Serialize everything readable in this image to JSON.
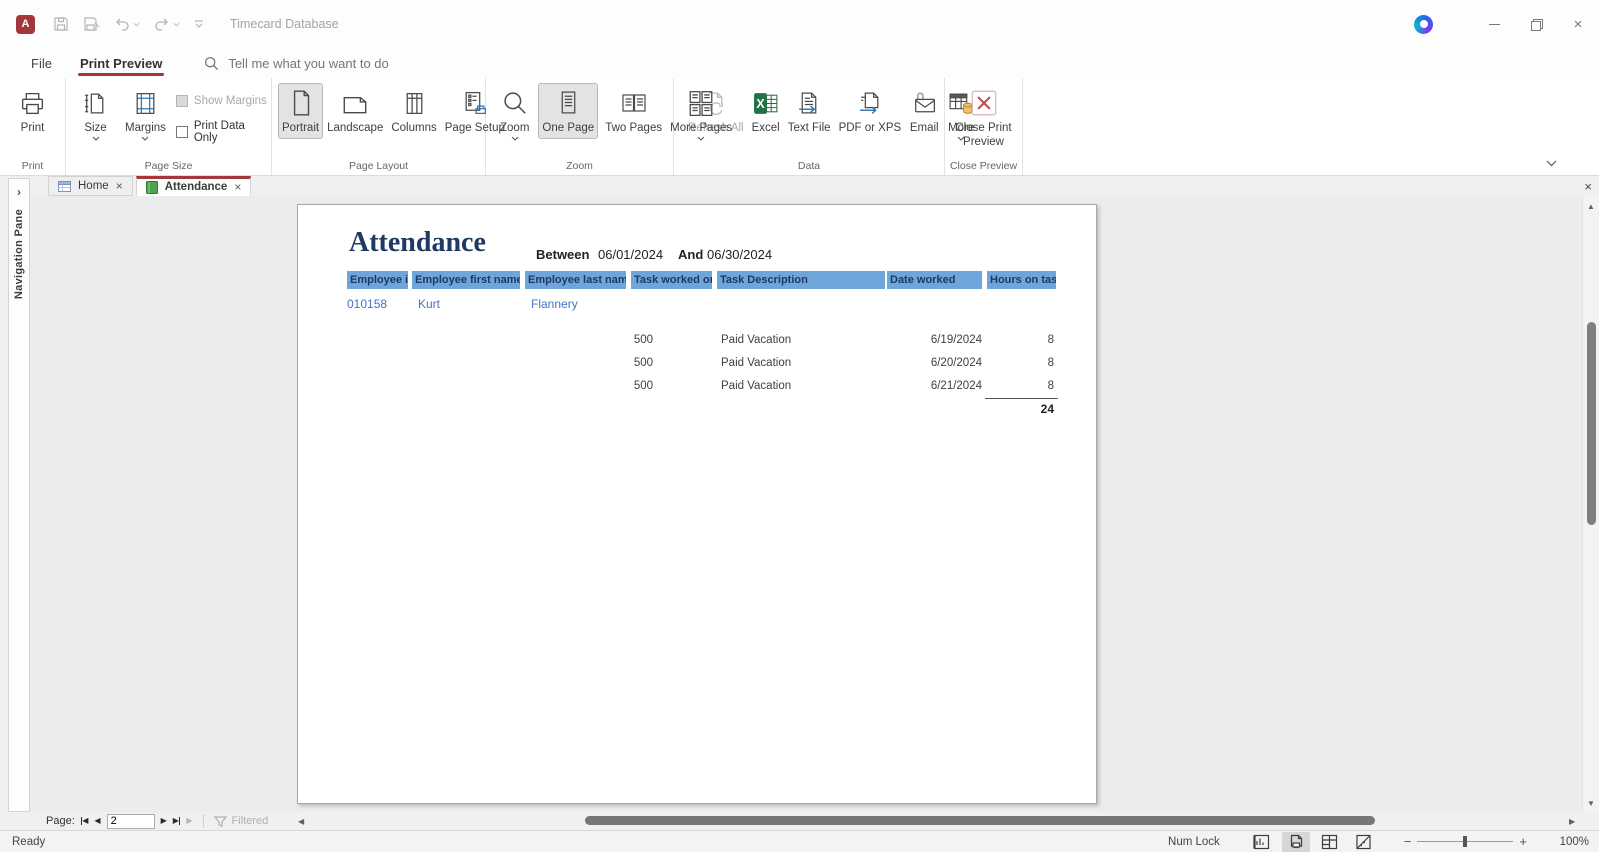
{
  "titlebar": {
    "title": "Timecard Database"
  },
  "menubar": {
    "file": "File",
    "print_preview": "Print Preview",
    "tell_me": "Tell me what you want to do"
  },
  "ribbon": {
    "print": {
      "label": "Print",
      "group": "Print"
    },
    "page_size": {
      "size": "Size",
      "margins": "Margins",
      "show_margins": "Show Margins",
      "print_data_only": "Print Data Only",
      "group": "Page Size"
    },
    "page_layout": {
      "portrait": "Portrait",
      "landscape": "Landscape",
      "columns": "Columns",
      "page_setup": "Page Setup",
      "group": "Page Layout"
    },
    "zoom": {
      "zoom": "Zoom",
      "one_page": "One Page",
      "two_pages": "Two Pages",
      "more_pages": "More Pages",
      "group": "Zoom"
    },
    "data": {
      "refresh_all": "Refresh All",
      "excel": "Excel",
      "text_file": "Text File",
      "pdf_or_xps": "PDF or XPS",
      "email": "Email",
      "more": "More",
      "group": "Data"
    },
    "close_preview": {
      "close_print_preview": "Close Print Preview",
      "group": "Close Preview"
    }
  },
  "navigation_pane": {
    "label": "Navigation Pane"
  },
  "object_tabs": [
    {
      "label": "Home"
    },
    {
      "label": "Attendance"
    }
  ],
  "report": {
    "title": "Attendance",
    "between_label": "Between",
    "start_date": "06/01/2024",
    "and_label": "And",
    "end_date": "06/30/2024",
    "columns": [
      "Employee id",
      "Employee first name",
      "Employee last name",
      "Task worked on",
      "Task Description",
      "Date worked",
      "Hours on task"
    ],
    "employee": {
      "id": "010158",
      "first_name": "Kurt",
      "last_name": "Flannery"
    },
    "rows": [
      {
        "task": "500",
        "description": "Paid Vacation",
        "date": "6/19/2024",
        "hours": "8"
      },
      {
        "task": "500",
        "description": "Paid Vacation",
        "date": "6/20/2024",
        "hours": "8"
      },
      {
        "task": "500",
        "description": "Paid Vacation",
        "date": "6/21/2024",
        "hours": "8"
      }
    ],
    "total_hours": "24"
  },
  "page_nav": {
    "label": "Page:",
    "current_page": "2",
    "filtered_label": "Filtered"
  },
  "status_bar": {
    "status": "Ready",
    "num_lock": "Num Lock",
    "zoom_level": "100%"
  },
  "icons": {
    "close": "×",
    "prev": "◀",
    "next": "▶",
    "up": "▲",
    "down": "▼",
    "minus": "−",
    "plus": "+",
    "expand": "›"
  },
  "colors": {
    "accent_red": "#a4373a",
    "header_blue": "#6ea6dc",
    "header_text": "#1f3864",
    "link_blue": "#4472c4",
    "excel_green": "#217346"
  }
}
